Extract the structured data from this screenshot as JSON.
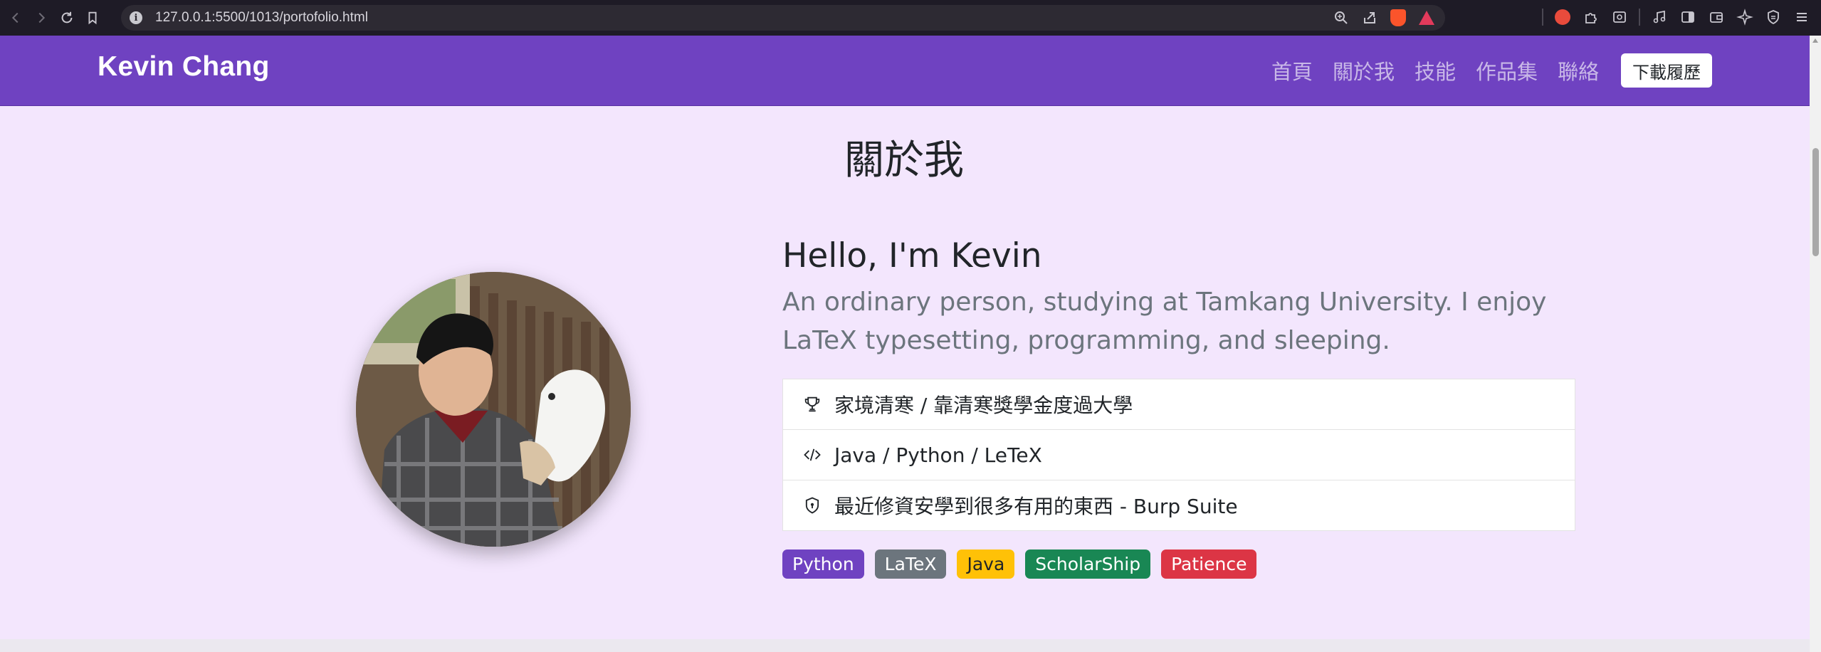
{
  "browser": {
    "url": "127.0.0.1:5500/1013/portofolio.html",
    "theme": "#1e1b26"
  },
  "navbar": {
    "brand": "Kevin Chang",
    "links": [
      "首頁",
      "關於我",
      "技能",
      "作品集",
      "聯絡"
    ],
    "download_label": "下載履歷",
    "bg_color": "#6f42c1"
  },
  "about": {
    "title": "關於我",
    "greeting": "Hello, I'm Kevin",
    "lead": "An ordinary person, studying at Tamkang University. I enjoy LaTeX typesetting, programming, and sleeping.",
    "items": [
      {
        "icon": "trophy-icon",
        "text": "家境清寒 / 靠清寒獎學金度過大學"
      },
      {
        "icon": "code-icon",
        "text": "Java / Python / LeTeX"
      },
      {
        "icon": "shield-icon",
        "text": "最近修資安學到很多有用的東西 - Burp Suite"
      }
    ],
    "badges": [
      {
        "label": "Python",
        "color": "#6f42c1",
        "text_color": "#ffffff"
      },
      {
        "label": "LaTeX",
        "color": "#6c757d",
        "text_color": "#ffffff"
      },
      {
        "label": "Java",
        "color": "#ffc107",
        "text_color": "#212529"
      },
      {
        "label": "ScholarShip",
        "color": "#198754",
        "text_color": "#ffffff"
      },
      {
        "label": "Patience",
        "color": "#dc3545",
        "text_color": "#ffffff"
      }
    ]
  }
}
